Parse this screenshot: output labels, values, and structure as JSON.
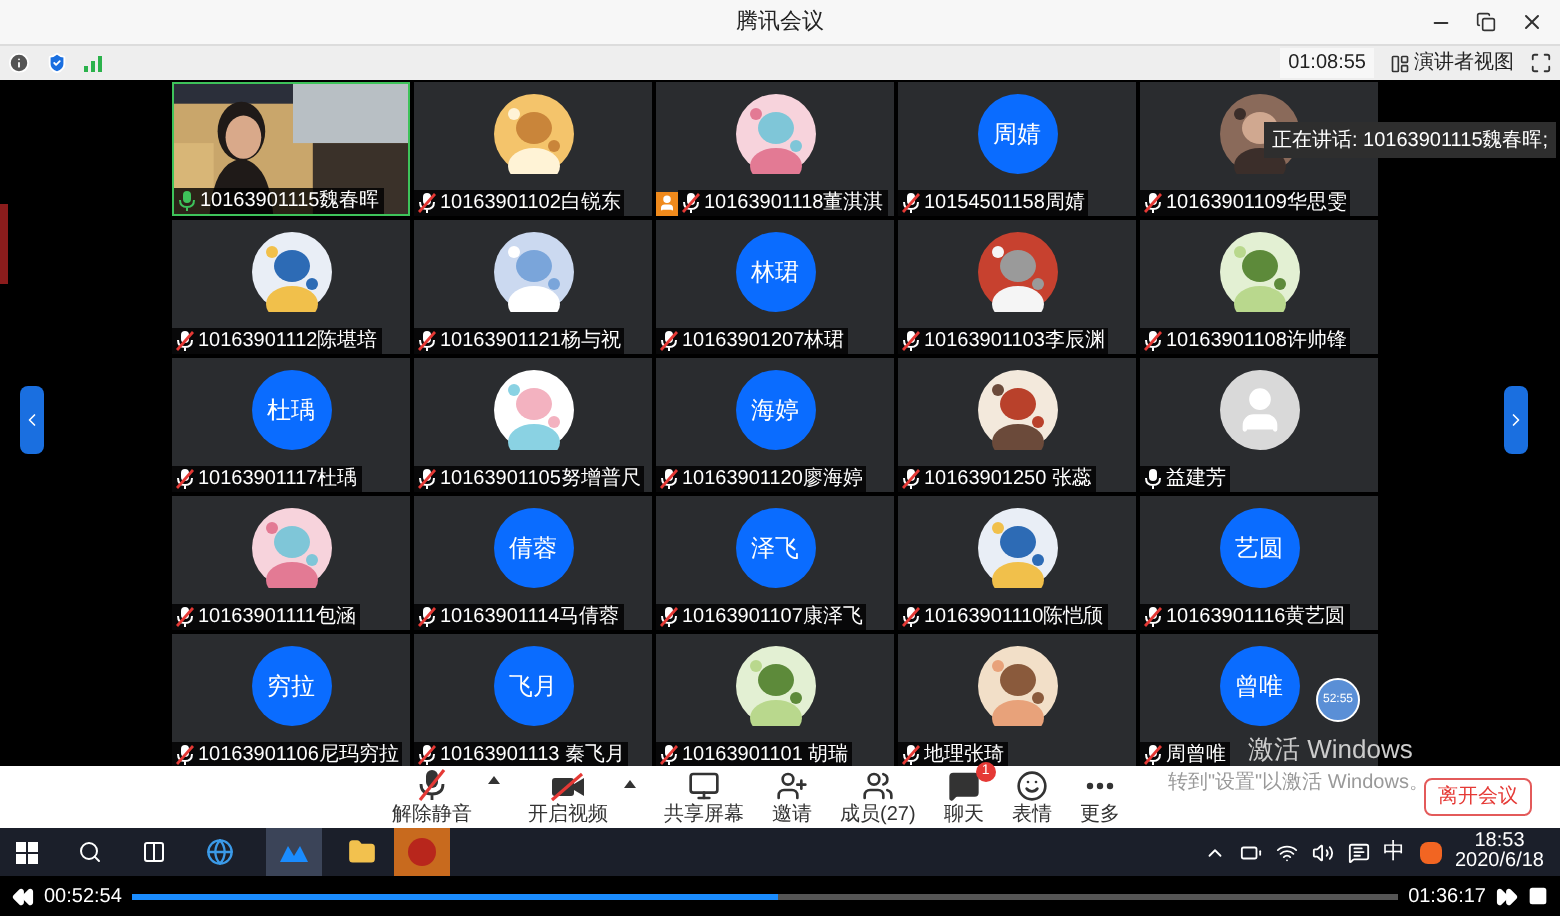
{
  "window": {
    "title": "腾讯会议"
  },
  "info_bar": {
    "duration": "01:08:55",
    "view_button": "演讲者视图"
  },
  "speaking_tip": "正在讲话: 10163901115魏春晖;",
  "tiles": [
    {
      "name": "10163901115魏春晖",
      "kind": "video",
      "muted": false,
      "speaking": true,
      "role_icon": false
    },
    {
      "name": "10163901102白锐东",
      "muted": true,
      "speaking": false,
      "role_icon": false
    },
    {
      "name": "10163901118董淇淇",
      "muted": true,
      "speaking": false,
      "role_icon": true
    },
    {
      "name": "10154501158周婧",
      "kind": "initials",
      "initials": "周婧",
      "muted": true,
      "speaking": false,
      "role_icon": false
    },
    {
      "name": "10163901109华思雯",
      "muted": true,
      "speaking": false,
      "role_icon": false
    },
    {
      "name": "10163901112陈堪培",
      "muted": true,
      "speaking": false,
      "role_icon": false
    },
    {
      "name": "10163901121杨与祝",
      "muted": true,
      "speaking": false,
      "role_icon": false
    },
    {
      "name": "10163901207林珺",
      "kind": "initials",
      "initials": "林珺",
      "muted": true,
      "speaking": false,
      "role_icon": false
    },
    {
      "name": "10163901103李辰渊",
      "muted": true,
      "speaking": false,
      "role_icon": false
    },
    {
      "name": "10163901108许帅锋",
      "muted": true,
      "speaking": false,
      "role_icon": false
    },
    {
      "name": "10163901117杜瑀",
      "kind": "initials",
      "initials": "杜瑀",
      "muted": true,
      "speaking": false,
      "role_icon": false
    },
    {
      "name": "10163901105努增普尺",
      "muted": true,
      "speaking": false,
      "role_icon": false
    },
    {
      "name": "10163901120廖海婷",
      "kind": "initials",
      "initials": "海婷",
      "muted": true,
      "speaking": false,
      "role_icon": false
    },
    {
      "name": "10163901250 张蕊",
      "muted": true,
      "speaking": false,
      "role_icon": false
    },
    {
      "name": "益建芳",
      "kind": "default",
      "muted": false,
      "speaking": false,
      "role_icon": false
    },
    {
      "name": "10163901111包涵",
      "muted": true,
      "speaking": false,
      "role_icon": false
    },
    {
      "name": "10163901114马倩蓉",
      "kind": "initials",
      "initials": "倩蓉",
      "muted": true,
      "speaking": false,
      "role_icon": false
    },
    {
      "name": "10163901107康泽飞",
      "kind": "initials",
      "initials": "泽飞",
      "muted": true,
      "speaking": false,
      "role_icon": false
    },
    {
      "name": "10163901110陈恺颀",
      "muted": true,
      "speaking": false,
      "role_icon": false
    },
    {
      "name": "10163901116黄艺圆",
      "kind": "initials",
      "initials": "艺圆",
      "muted": true,
      "speaking": false,
      "role_icon": false
    },
    {
      "name": "10163901106尼玛穷拉",
      "kind": "initials",
      "initials": "穷拉",
      "muted": true,
      "speaking": false,
      "role_icon": false
    },
    {
      "name": "10163901113 秦飞月",
      "kind": "initials",
      "initials": "飞月",
      "muted": true,
      "speaking": false,
      "role_icon": false
    },
    {
      "name": "10163901101 胡瑞",
      "muted": true,
      "speaking": false,
      "role_icon": false
    },
    {
      "name": "地理张琦",
      "muted": true,
      "speaking": false,
      "role_icon": false
    },
    {
      "name": "周曾唯",
      "kind": "initials",
      "initials": "曾唯",
      "muted": true,
      "speaking": false,
      "role_icon": false,
      "timer": "52:55"
    }
  ],
  "activation_notice": {
    "title": "激活 Windows",
    "text": "转到\"设置\"以激活 Windows。"
  },
  "toolbar": [
    {
      "kind": "mic",
      "label": "解除静音",
      "has_menu": true
    },
    {
      "kind": "video",
      "label": "开启视频",
      "has_menu": true
    },
    {
      "kind": "share",
      "label": "共享屏幕",
      "has_menu": false
    },
    {
      "kind": "invite",
      "label": "邀请",
      "has_menu": false
    },
    {
      "kind": "members",
      "label": "成员(27)",
      "has_menu": false
    },
    {
      "kind": "chat",
      "label": "聊天",
      "has_menu": false,
      "badge": "1"
    },
    {
      "kind": "emoji",
      "label": "表情",
      "has_menu": false
    },
    {
      "kind": "more",
      "label": "更多",
      "has_menu": false
    }
  ],
  "leave_button": "离开会议",
  "taskbar": {
    "ime": "中",
    "time": "18:53",
    "date": "2020/6/18"
  },
  "player": {
    "elapsed": "00:52:54",
    "total": "01:36:17",
    "level": 0.51
  }
}
